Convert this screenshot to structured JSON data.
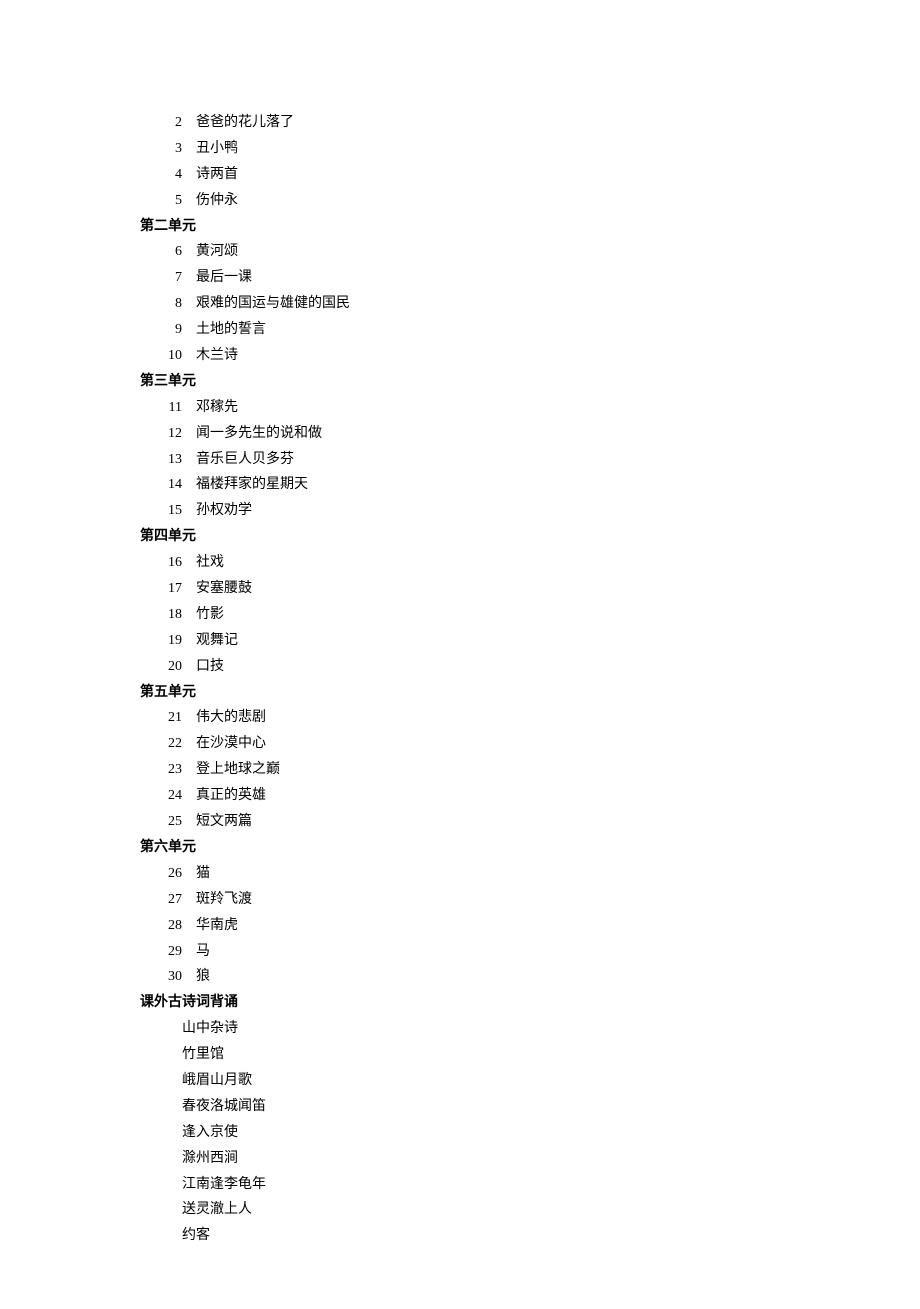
{
  "initial_items": [
    {
      "num": "2",
      "title": "爸爸的花儿落了"
    },
    {
      "num": "3",
      "title": "丑小鸭"
    },
    {
      "num": "4",
      "title": "诗两首"
    },
    {
      "num": "5",
      "title": "伤仲永"
    }
  ],
  "unit2": {
    "heading": "第二单元",
    "items": [
      {
        "num": "6",
        "title": "黄河颂"
      },
      {
        "num": "7",
        "title": "最后一课"
      },
      {
        "num": "8",
        "title": "艰难的国运与雄健的国民"
      },
      {
        "num": "9",
        "title": "土地的誓言"
      },
      {
        "num": "10",
        "title": "木兰诗"
      }
    ]
  },
  "unit3": {
    "heading": "第三单元",
    "items": [
      {
        "num": "11",
        "title": "邓稼先"
      },
      {
        "num": "12",
        "title": "闻一多先生的说和做"
      },
      {
        "num": "13",
        "title": "音乐巨人贝多芬"
      },
      {
        "num": "14",
        "title": "福楼拜家的星期天"
      },
      {
        "num": "15",
        "title": "孙权劝学"
      }
    ]
  },
  "unit4": {
    "heading": "第四单元",
    "items": [
      {
        "num": "16",
        "title": "社戏"
      },
      {
        "num": "17",
        "title": "安塞腰鼓"
      },
      {
        "num": "18",
        "title": "竹影"
      },
      {
        "num": "19",
        "title": "观舞记"
      },
      {
        "num": "20",
        "title": "口技"
      }
    ]
  },
  "unit5": {
    "heading": "第五单元",
    "items": [
      {
        "num": "21",
        "title": "伟大的悲剧"
      },
      {
        "num": "22",
        "title": "在沙漠中心"
      },
      {
        "num": "23",
        "title": "登上地球之巅"
      },
      {
        "num": "24",
        "title": "真正的英雄"
      },
      {
        "num": "25",
        "title": "短文两篇"
      }
    ]
  },
  "unit6": {
    "heading": "第六单元",
    "items": [
      {
        "num": "26",
        "title": "猫"
      },
      {
        "num": "27",
        "title": "斑羚飞渡"
      },
      {
        "num": "28",
        "title": "华南虎"
      },
      {
        "num": "29",
        "title": "马"
      },
      {
        "num": "30",
        "title": "狼"
      }
    ]
  },
  "poems": {
    "heading": "课外古诗词背诵",
    "items": [
      "山中杂诗",
      "竹里馆",
      "峨眉山月歌",
      "春夜洛城闻笛",
      "逢入京使",
      "滁州西涧",
      "江南逢李龟年",
      "送灵澈上人",
      "约客"
    ]
  }
}
